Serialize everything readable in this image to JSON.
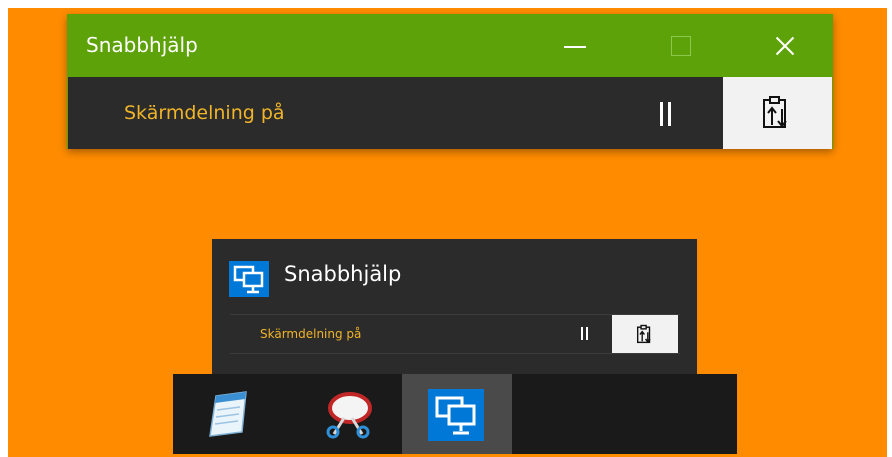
{
  "large_window": {
    "title": "Snabbhjälp",
    "status": "Skärmdelning på",
    "title_bar_color": "#5ea20a",
    "status_color": "#f0b429"
  },
  "small_window": {
    "title": "Snabbhjälp",
    "status": "Skärmdelning på"
  },
  "taskbar": {
    "items": [
      {
        "icon": "notepad-icon"
      },
      {
        "icon": "snipping-tool-icon"
      },
      {
        "icon": "quick-assist-icon",
        "active": true
      }
    ]
  },
  "colors": {
    "desktop_background": "#ff8c00",
    "window_body": "#2b2b2b",
    "taskbar": "#1a1a1a",
    "accent_blue": "#0078d7"
  }
}
